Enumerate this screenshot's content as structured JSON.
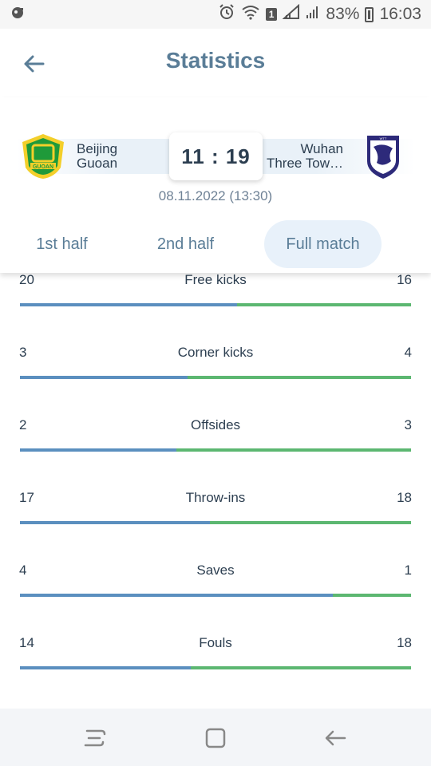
{
  "status_bar": {
    "battery_percent": "83%",
    "time": "16:03",
    "sim_badge": "1"
  },
  "header": {
    "title": "Statistics"
  },
  "match": {
    "home": {
      "name_line1": "Beijing",
      "name_line2": "Guoan",
      "logo_text": "GUOAN"
    },
    "away": {
      "name_line1": "Wuhan",
      "name_line2": "Three Tow…",
      "logo_text": "WTT"
    },
    "score": "11 : 19",
    "date": "08.11.2022 (13:30)"
  },
  "tabs": [
    {
      "label": "1st half"
    },
    {
      "label": "2nd half"
    },
    {
      "label": "Full match"
    }
  ],
  "colors": {
    "home_bar": "#5b8fbf",
    "away_bar": "#5cb771",
    "accent": "#5a7d97"
  },
  "stats": [
    {
      "label": "Free kicks",
      "home": "20",
      "away": "16"
    },
    {
      "label": "Corner kicks",
      "home": "3",
      "away": "4"
    },
    {
      "label": "Offsides",
      "home": "2",
      "away": "3"
    },
    {
      "label": "Throw-ins",
      "home": "17",
      "away": "18"
    },
    {
      "label": "Saves",
      "home": "4",
      "away": "1"
    },
    {
      "label": "Fouls",
      "home": "14",
      "away": "18"
    }
  ],
  "nav": {
    "icons": [
      "recents-icon",
      "home-icon",
      "back-icon"
    ]
  }
}
